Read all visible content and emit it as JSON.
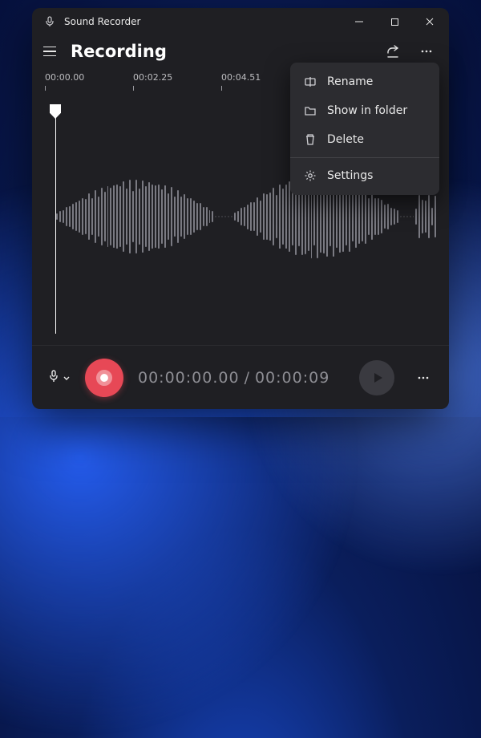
{
  "app": {
    "title": "Sound Recorder"
  },
  "header": {
    "page_title": "Recording"
  },
  "timeline": {
    "marks": [
      "00:00.00",
      "00:02.25",
      "00:04.51"
    ]
  },
  "transport": {
    "elapsed": "00:00:00.00",
    "separator": "/",
    "total": "00:00:09"
  },
  "menu": {
    "rename": "Rename",
    "show_in_folder": "Show in folder",
    "delete": "Delete",
    "settings": "Settings"
  },
  "colors": {
    "accent": "#e74856",
    "window_bg": "#1f1f23"
  }
}
